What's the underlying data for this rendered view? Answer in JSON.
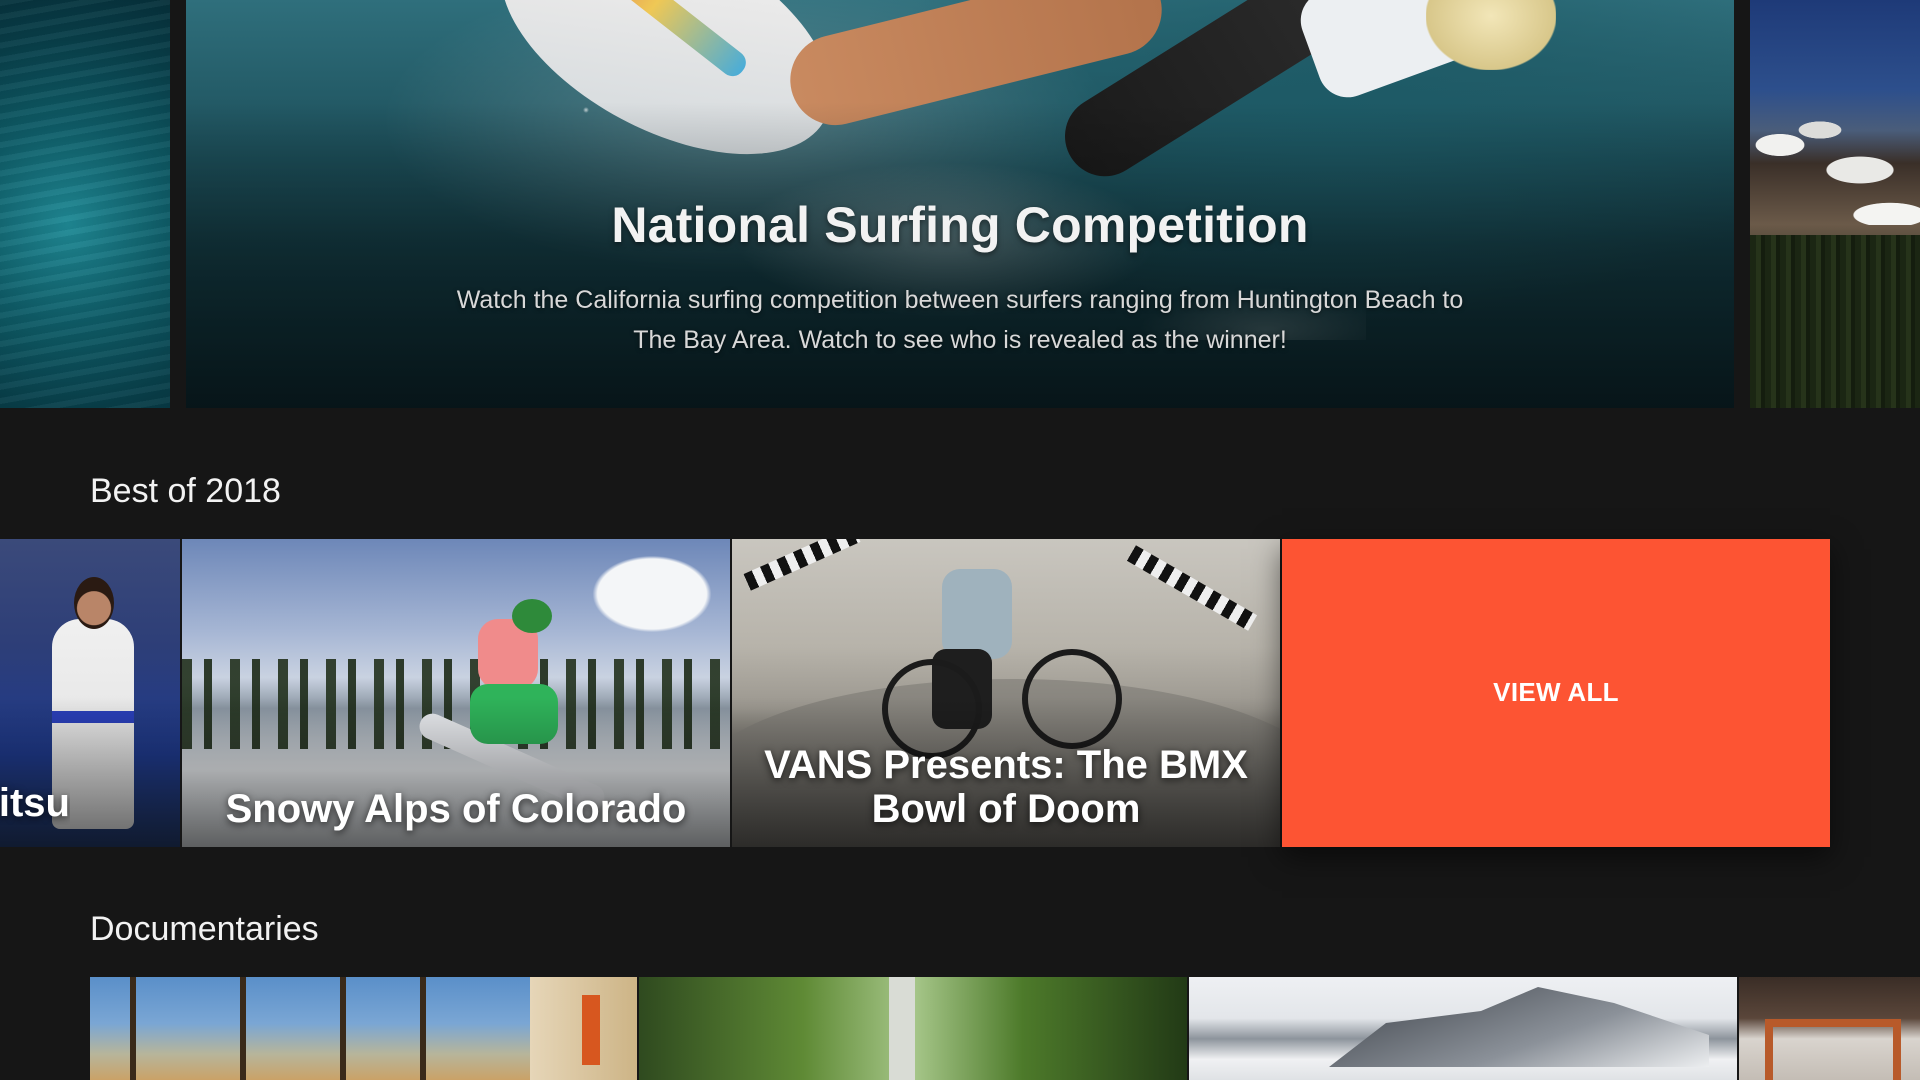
{
  "hero": {
    "title": "National Surfing Competition",
    "description": "Watch the California surfing competition between surfers ranging from Huntington Beach to The Bay Area. Watch to see who is revealed as the winner!"
  },
  "rows": {
    "best_of_2018": {
      "title": "Best of 2018",
      "items": [
        {
          "label": "Jiu-Jitsu"
        },
        {
          "label": "Snowy Alps of Colorado"
        },
        {
          "label": "VANS Presents: The BMX Bowl of Doom"
        }
      ],
      "view_all_label": "VIEW ALL"
    },
    "documentaries": {
      "title": "Documentaries"
    }
  },
  "colors": {
    "background": "#161616",
    "accent": "#fd5433"
  }
}
